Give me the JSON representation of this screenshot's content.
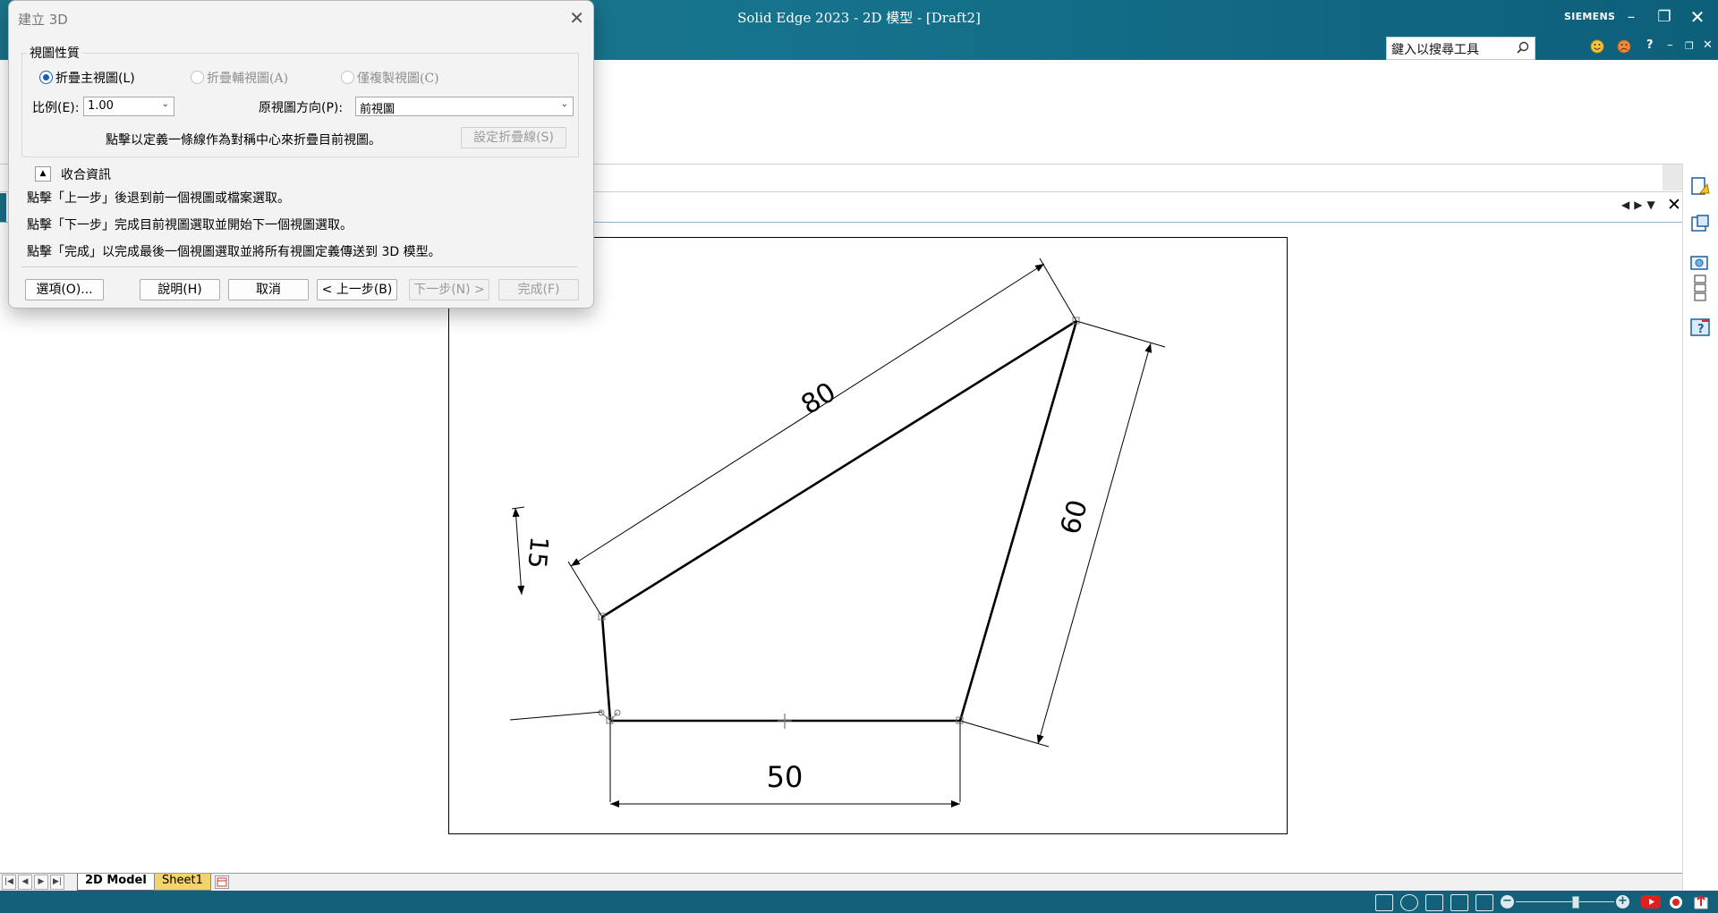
{
  "window": {
    "title": "Solid Edge 2023 - 2D 模型 - [Draft2]",
    "brand": "SIEMENS",
    "search_placeholder": "鍵入以搜尋工具",
    "help_label": "?"
  },
  "dialog": {
    "title": "建立 3D",
    "group_label": "視圖性質",
    "radios": [
      {
        "label": "折疊主視圖(L)",
        "selected": true,
        "enabled": true
      },
      {
        "label": "折疊輔視圖(A)",
        "selected": false,
        "enabled": false
      },
      {
        "label": "僅複製視圖(C)",
        "selected": false,
        "enabled": false
      }
    ],
    "scale_label": "比例(E):",
    "scale_value": "1.00",
    "orientation_label": "原視圖方向(P):",
    "orientation_value": "前視圖",
    "fold_instruction": "點擊以定義一條線作為對稱中心來折疊目前視圖。",
    "fold_line_button": "設定折疊線(S)",
    "collapse_label": "收合資訊",
    "info_lines": [
      "點擊「上一步」後退到前一個視圖或檔案選取。",
      "點擊「下一步」完成目前視圖選取並開始下一個視圖選取。",
      "點擊「完成」以完成最後一個視圖選取並將所有視圖定義傳送到 3D 模型。"
    ],
    "buttons": {
      "options": "選項(O)...",
      "help": "說明(H)",
      "cancel": "取消",
      "back": "< 上一步(B)",
      "next": "下一步(N) >",
      "finish": "完成(F)"
    }
  },
  "drawing": {
    "dimensions": {
      "top": "80",
      "right": "60",
      "left": "15",
      "bottom": "50"
    }
  },
  "sheet_tabs": [
    "2D Model",
    "Sheet1"
  ],
  "colors": {
    "titlebar": "#16738d",
    "statusbar": "#12607a",
    "accent": "#1a5fb4"
  }
}
